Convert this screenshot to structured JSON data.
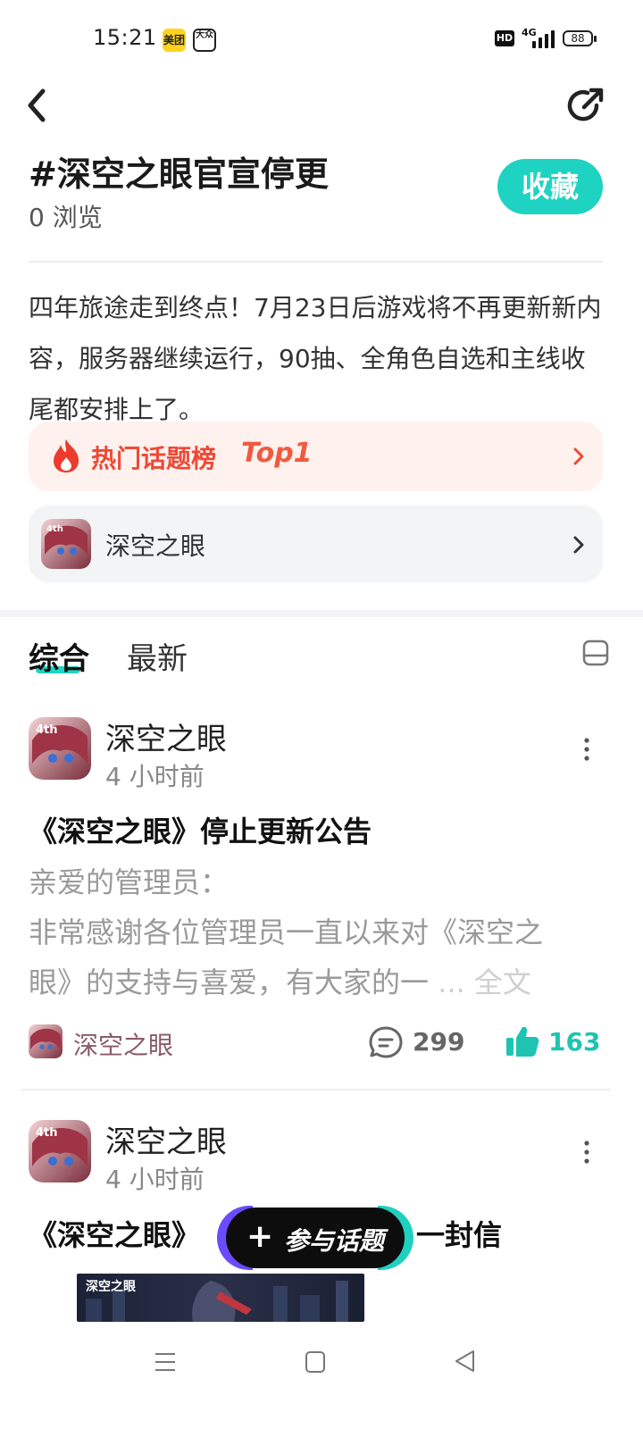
{
  "status_bar": {
    "time": "15:21",
    "app_icons": [
      "美团",
      "大众"
    ],
    "hd": "HD",
    "network": "4G",
    "battery": "88"
  },
  "header": {
    "back_icon": "chevron-left-icon",
    "share_icon": "share-icon",
    "title": "#深空之眼官宣停更",
    "views": "0 浏览",
    "collect_label": "收藏",
    "accent_color": "#1ed3c2"
  },
  "description": "四年旅途走到终点！7月23日后游戏将不再更新新内容，服务器继续运行，90抽、全角色自选和主线收尾都安排上了。",
  "hot_rank": {
    "label": "热门话题榜",
    "rank": "Top1",
    "color": "#ec4a36"
  },
  "game_link": {
    "name": "深空之眼"
  },
  "tabs": [
    {
      "label": "综合",
      "active": true
    },
    {
      "label": "最新",
      "active": false
    }
  ],
  "posts": [
    {
      "author": "深空之眼",
      "time": "4 小时前",
      "title": "《深空之眼》停止更新公告",
      "body_line1": "亲爱的管理员：",
      "body_line2": "非常感谢各位管理员一直以来对《深空之",
      "body_line3": "眼》的支持与喜爱，有大家的一",
      "more": "... 全文",
      "source": "深空之眼",
      "comments": "299",
      "likes": "163"
    },
    {
      "author": "深空之眼",
      "time": "4 小时前",
      "title_left": "《深空之眼》",
      "title_right": "一封信",
      "banner_text": "深空之眼"
    }
  ],
  "join_button": {
    "label": "参与话题",
    "plus": "+"
  },
  "nav": {
    "menu_icon": "menu-icon",
    "home_icon": "home-icon",
    "back_icon": "back-triangle-icon"
  }
}
